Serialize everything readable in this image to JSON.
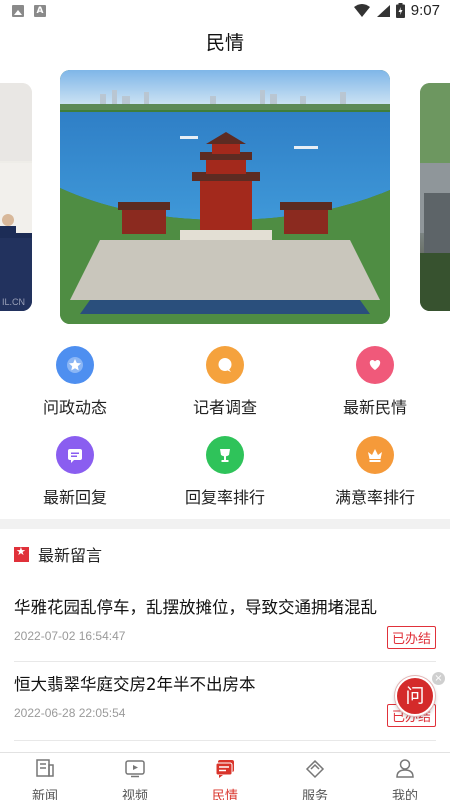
{
  "status_bar": {
    "time": "9:07"
  },
  "header": {
    "title": "民情"
  },
  "grid": {
    "items": [
      {
        "label": "问政动态",
        "icon": "star-badge-icon",
        "color": "#4e8ff0"
      },
      {
        "label": "记者调查",
        "icon": "chat-bubble-icon",
        "color": "#f5a23d"
      },
      {
        "label": "最新民情",
        "icon": "heart-hands-icon",
        "color": "#f0597a"
      },
      {
        "label": "最新回复",
        "icon": "message-icon",
        "color": "#8a5ef0"
      },
      {
        "label": "回复率排行",
        "icon": "trophy-icon",
        "color": "#2fc35a"
      },
      {
        "label": "满意率排行",
        "icon": "crown-icon",
        "color": "#f59a3a"
      }
    ]
  },
  "latest": {
    "title": "最新留言",
    "items": [
      {
        "title": "华雅花园乱停车，乱摆放摊位，导致交通拥堵混乱",
        "date": "2022-07-02 16:54:47",
        "status": "已办结"
      },
      {
        "title": "恒大翡翠华庭交房2年半不出房本",
        "date": "2022-06-28 22:05:54",
        "status": "已办结"
      }
    ]
  },
  "float_button": {
    "label": "问",
    "close": "×"
  },
  "bottom_nav": {
    "items": [
      {
        "label": "新闻",
        "icon": "news-icon",
        "active": false
      },
      {
        "label": "视频",
        "icon": "video-icon",
        "active": false
      },
      {
        "label": "民情",
        "icon": "public-opinion-icon",
        "active": true
      },
      {
        "label": "服务",
        "icon": "service-icon",
        "active": false
      },
      {
        "label": "我的",
        "icon": "profile-icon",
        "active": false
      }
    ]
  },
  "colors": {
    "accent": "#d9342b",
    "badge": "#e0313a"
  }
}
